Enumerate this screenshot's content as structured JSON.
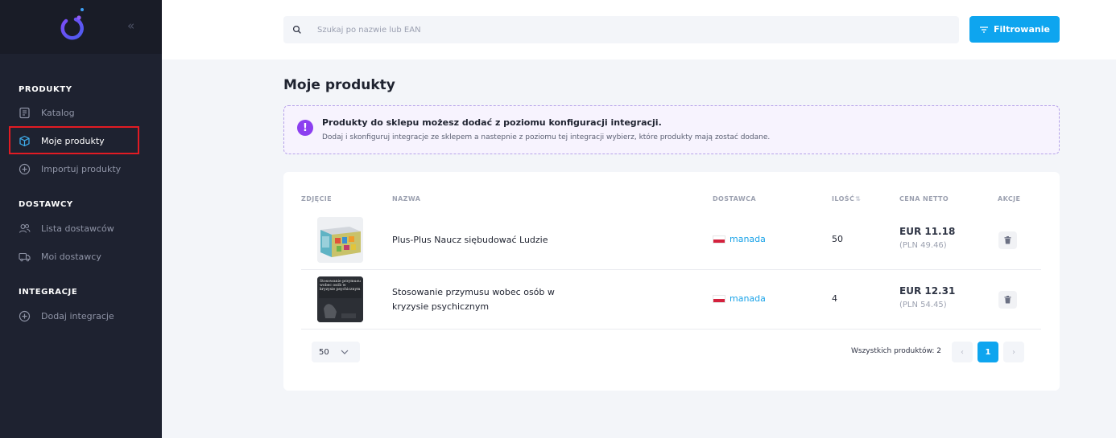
{
  "sidebar": {
    "collapse_glyph": "«",
    "sections": [
      {
        "title": "PRODUKTY",
        "items": [
          {
            "label": "Katalog",
            "icon": "catalog-icon"
          },
          {
            "label": "Moje produkty",
            "icon": "box-icon",
            "active": true
          },
          {
            "label": "Importuj produkty",
            "icon": "plus-circle-icon"
          }
        ]
      },
      {
        "title": "DOSTAWCY",
        "items": [
          {
            "label": "Lista dostawców",
            "icon": "users-icon"
          },
          {
            "label": "Moi dostawcy",
            "icon": "truck-icon"
          }
        ]
      },
      {
        "title": "INTEGRACJE",
        "items": [
          {
            "label": "Dodaj integracje",
            "icon": "plus-circle-icon"
          }
        ]
      }
    ]
  },
  "header": {
    "search_placeholder": "Szukaj po nazwie lub EAN",
    "filter_label": "Filtrowanie"
  },
  "page": {
    "title": "Moje produkty"
  },
  "info": {
    "icon_glyph": "!",
    "title": "Produkty do sklepu możesz dodać z poziomu konfiguracji integracji.",
    "text": "Dodaj i skonfiguruj integracje ze sklepem a nastepnie z poziomu tej integracji wybierz, które produkty mają zostać dodane."
  },
  "table": {
    "columns": {
      "photo": "ZDJĘCIE",
      "name": "NAZWA",
      "supplier": "DOSTAWCA",
      "qty": "ILOŚĆ",
      "qty_sort_glyph": "⇅",
      "price": "CENA NETTO",
      "actions": "AKCJE"
    },
    "rows": [
      {
        "name": "Plus-Plus Naucz siębudować Ludzie",
        "supplier": "manada",
        "qty": "50",
        "price": "EUR 11.18",
        "price_pln": "(PLN 49.46)"
      },
      {
        "name": "Stosowanie przymusu wobec osób w kryzysie psychicznym",
        "supplier": "manada",
        "qty": "4",
        "price": "EUR 12.31",
        "price_pln": "(PLN 54.45)",
        "thumb_text": "Stosowanie przymusu wobec osób w kryzysie psychicznym"
      }
    ]
  },
  "pagination": {
    "per_page": "50",
    "total_label": "Wszystkich produktów: 2",
    "prev_glyph": "‹",
    "current": "1",
    "next_glyph": "›"
  },
  "colors": {
    "sidebar_bg": "#1e2230",
    "accent_blue": "#0ea5ef",
    "accent_purple": "#8c3ff0",
    "highlight_red": "#e21b23"
  }
}
